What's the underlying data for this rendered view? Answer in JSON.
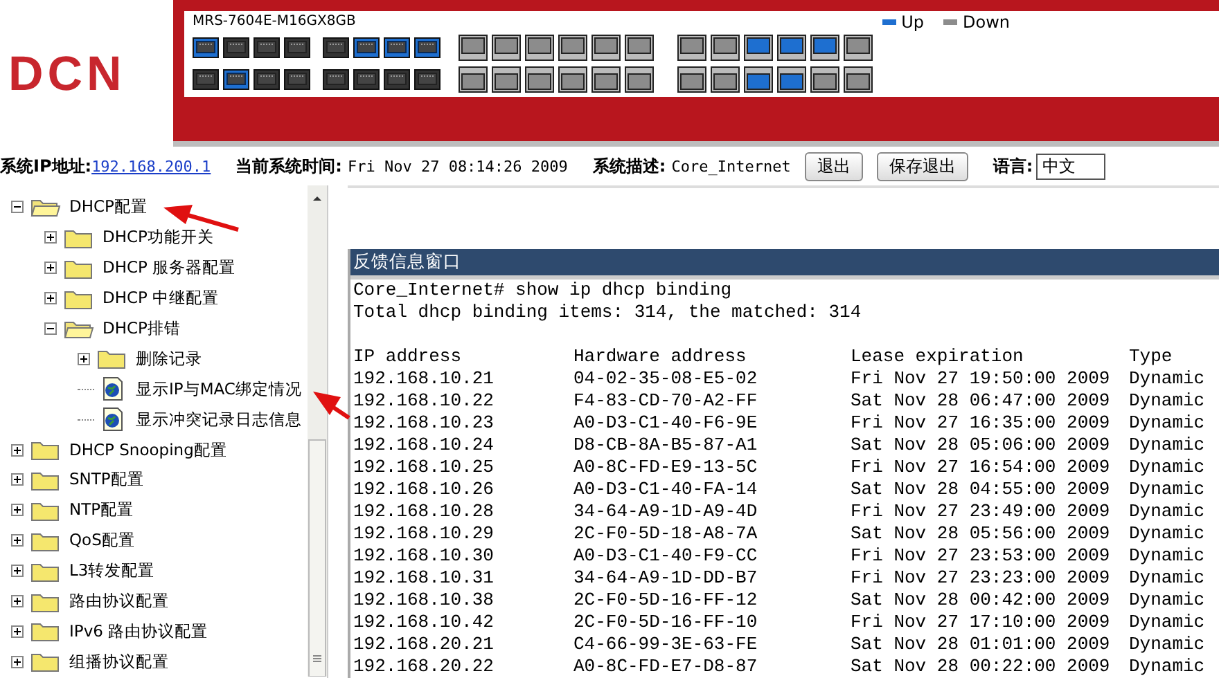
{
  "logo": "DCN",
  "device": {
    "model": "MRS-7604E-M16GX8GB",
    "legend": [
      {
        "label": "Up",
        "color": "#1e6fd0"
      },
      {
        "label": "Down",
        "color": "#8c8c8c"
      }
    ],
    "rows": [
      {
        "groups": [
          {
            "kind": "rj45",
            "ports": [
              true,
              false,
              false,
              false
            ]
          },
          {
            "kind": "rj45",
            "ports": [
              false,
              true,
              true,
              true
            ]
          },
          {
            "kind": "sfp",
            "ports": [
              false,
              false,
              false,
              false,
              false,
              false
            ]
          },
          {
            "kind": "sfp",
            "ports": [
              false,
              false,
              true,
              true,
              true,
              false
            ]
          }
        ]
      },
      {
        "groups": [
          {
            "kind": "rj45",
            "ports": [
              false,
              true,
              false,
              false
            ]
          },
          {
            "kind": "rj45",
            "ports": [
              false,
              false,
              false,
              false
            ]
          },
          {
            "kind": "sfp",
            "ports": [
              false,
              false,
              false,
              false,
              false,
              false
            ]
          },
          {
            "kind": "sfp",
            "ports": [
              false,
              false,
              true,
              true,
              false,
              false
            ]
          }
        ]
      }
    ]
  },
  "info": {
    "ip_label": "系统IP地址:",
    "ip": "192.168.200.1",
    "time_label": "当前系统时间:",
    "time": "Fri Nov 27 08:14:26 2009",
    "desc_label": "系统描述:",
    "desc": "Core_Internet",
    "buttons": [
      "退出",
      "保存退出"
    ],
    "lang_label": "语言:",
    "lang": "中文"
  },
  "tree": [
    {
      "label": "DHCP配置",
      "kind": "folder",
      "expanded": true,
      "children": [
        {
          "label": "DHCP功能开关",
          "kind": "folder",
          "expanded": false
        },
        {
          "label": "DHCP 服务器配置",
          "kind": "folder",
          "expanded": false
        },
        {
          "label": "DHCP 中继配置",
          "kind": "folder",
          "expanded": false
        },
        {
          "label": "DHCP排错",
          "kind": "folder",
          "expanded": true,
          "children": [
            {
              "label": "删除记录",
              "kind": "folder",
              "expanded": false
            },
            {
              "label": "显示IP与MAC绑定情况",
              "kind": "page"
            },
            {
              "label": "显示冲突记录日志信息",
              "kind": "page"
            }
          ]
        }
      ]
    },
    {
      "label": "DHCP Snooping配置",
      "kind": "folder",
      "expanded": false
    },
    {
      "label": "SNTP配置",
      "kind": "folder",
      "expanded": false
    },
    {
      "label": "NTP配置",
      "kind": "folder",
      "expanded": false
    },
    {
      "label": "QoS配置",
      "kind": "folder",
      "expanded": false
    },
    {
      "label": "L3转发配置",
      "kind": "folder",
      "expanded": false
    },
    {
      "label": "路由协议配置",
      "kind": "folder",
      "expanded": false
    },
    {
      "label": "IPv6 路由协议配置",
      "kind": "folder",
      "expanded": false
    },
    {
      "label": "组播协议配置",
      "kind": "folder",
      "expanded": false
    }
  ],
  "feedback": {
    "title": "反馈信息窗口",
    "lines": [
      "Core_Internet# show ip dhcp binding",
      "Total dhcp binding items: 314, the matched: 314"
    ],
    "columns": [
      "IP address",
      "Hardware address",
      "Lease expiration",
      "Type"
    ],
    "rows": [
      [
        "192.168.10.21",
        "04-02-35-08-E5-02",
        "Fri Nov 27 19:50:00 2009",
        "Dynamic"
      ],
      [
        "192.168.10.22",
        "F4-83-CD-70-A2-FF",
        "Sat Nov 28 06:47:00 2009",
        "Dynamic"
      ],
      [
        "192.168.10.23",
        "A0-D3-C1-40-F6-9E",
        "Fri Nov 27 16:35:00 2009",
        "Dynamic"
      ],
      [
        "192.168.10.24",
        "D8-CB-8A-B5-87-A1",
        "Sat Nov 28 05:06:00 2009",
        "Dynamic"
      ],
      [
        "192.168.10.25",
        "A0-8C-FD-E9-13-5C",
        "Fri Nov 27 16:54:00 2009",
        "Dynamic"
      ],
      [
        "192.168.10.26",
        "A0-D3-C1-40-FA-14",
        "Sat Nov 28 04:55:00 2009",
        "Dynamic"
      ],
      [
        "192.168.10.28",
        "34-64-A9-1D-A9-4D",
        "Fri Nov 27 23:49:00 2009",
        "Dynamic"
      ],
      [
        "192.168.10.29",
        "2C-F0-5D-18-A8-7A",
        "Sat Nov 28 05:56:00 2009",
        "Dynamic"
      ],
      [
        "192.168.10.30",
        "A0-D3-C1-40-F9-CC",
        "Fri Nov 27 23:53:00 2009",
        "Dynamic"
      ],
      [
        "192.168.10.31",
        "34-64-A9-1D-DD-B7",
        "Fri Nov 27 23:23:00 2009",
        "Dynamic"
      ],
      [
        "192.168.10.38",
        "2C-F0-5D-16-FF-12",
        "Sat Nov 28 00:42:00 2009",
        "Dynamic"
      ],
      [
        "192.168.10.42",
        "2C-F0-5D-16-FF-10",
        "Fri Nov 27 17:10:00 2009",
        "Dynamic"
      ],
      [
        "192.168.20.21",
        "C4-66-99-3E-63-FE",
        "Sat Nov 28 01:01:00 2009",
        "Dynamic"
      ],
      [
        "192.168.20.22",
        "A0-8C-FD-E7-D8-87",
        "Sat Nov 28 00:22:00 2009",
        "Dynamic"
      ]
    ]
  }
}
